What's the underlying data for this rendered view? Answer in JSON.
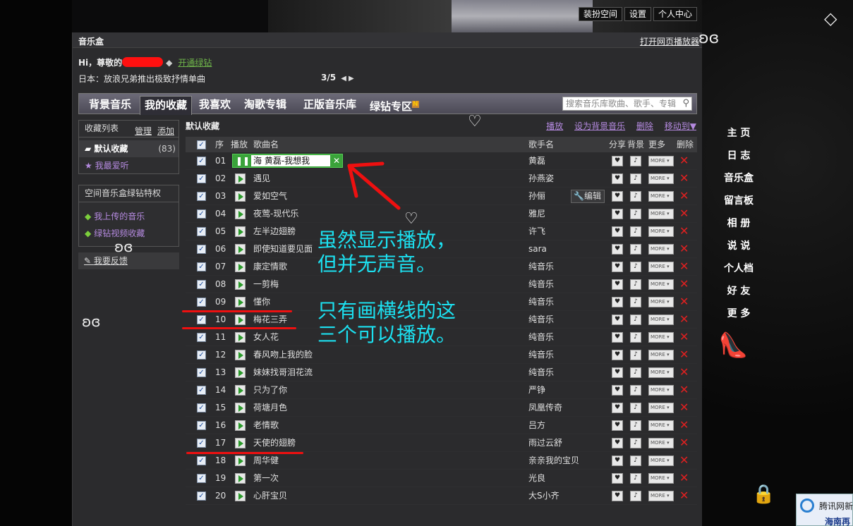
{
  "top_buttons": [
    "装扮空间",
    "设置",
    "个人中心"
  ],
  "panel": {
    "title": "音乐盒",
    "open_player": "打开网页播放器",
    "greeting_prefix": "Hi，尊敬的",
    "open_green": "开通绿钻",
    "news": "日本：放浪兄弟推出极致抒情单曲",
    "pager": "3/5"
  },
  "tabs": [
    "背景音乐",
    "我的收藏",
    "我喜欢",
    "淘歌专辑",
    "正版音乐库",
    "绿钻专区"
  ],
  "tab_badge": "N",
  "search_placeholder": "搜索音乐库歌曲、歌手、专辑",
  "sidebar": {
    "header": "收藏列表",
    "manage": "管理",
    "add": "添加",
    "items": [
      {
        "label": "默认收藏",
        "count": "(83)"
      },
      {
        "label": "我最爱听",
        "count": ""
      }
    ],
    "privilege_header": "空间音乐盒绿钻特权",
    "privilege_items": [
      "我上传的音乐",
      "绿钻视频收藏"
    ],
    "feedback": "我要反馈"
  },
  "list": {
    "title": "默认收藏",
    "actions": [
      "播放",
      "设为背景音乐",
      "删除",
      "移动到▼"
    ],
    "columns": [
      "序",
      "播放",
      "歌曲名",
      "歌手名",
      "分享",
      "背景",
      "更多",
      "删除"
    ],
    "more_label": "MORE",
    "edit_label": "编辑",
    "now_playing_text": "海 黄磊-我想我",
    "rows": [
      {
        "no": "01",
        "song": "",
        "artist": "黄磊"
      },
      {
        "no": "02",
        "song": "遇见",
        "artist": "孙燕姿"
      },
      {
        "no": "03",
        "song": "爱如空气",
        "artist": "孙俪"
      },
      {
        "no": "04",
        "song": "夜莺-现代乐",
        "artist": "雅尼"
      },
      {
        "no": "05",
        "song": "左半边翅膀",
        "artist": "许飞"
      },
      {
        "no": "06",
        "song": "即使知道要见面",
        "artist": "sara"
      },
      {
        "no": "07",
        "song": "康定情歌",
        "artist": "纯音乐"
      },
      {
        "no": "08",
        "song": "一剪梅",
        "artist": "纯音乐"
      },
      {
        "no": "09",
        "song": "懂你",
        "artist": "纯音乐"
      },
      {
        "no": "10",
        "song": "梅花三弄",
        "artist": "纯音乐"
      },
      {
        "no": "11",
        "song": "女人花",
        "artist": "纯音乐"
      },
      {
        "no": "12",
        "song": "春风吻上我的脸",
        "artist": "纯音乐"
      },
      {
        "no": "13",
        "song": "妹妹找哥泪花流",
        "artist": "纯音乐"
      },
      {
        "no": "14",
        "song": "只为了你",
        "artist": "严铮"
      },
      {
        "no": "15",
        "song": "荷塘月色",
        "artist": "凤凰传奇"
      },
      {
        "no": "16",
        "song": "老情歌",
        "artist": "吕方"
      },
      {
        "no": "17",
        "song": "天使的翅膀",
        "artist": "雨过云舒"
      },
      {
        "no": "18",
        "song": "周华健",
        "artist": "亲亲我的宝贝"
      },
      {
        "no": "19",
        "song": "第一次",
        "artist": "光良"
      },
      {
        "no": "20",
        "song": "心肝宝贝",
        "artist": "大S小齐"
      }
    ]
  },
  "right_nav": [
    "主 页",
    "日 志",
    "音乐盒",
    "留言板",
    "相 册",
    "说 说",
    "个人档",
    "好 友",
    "更 多"
  ],
  "annotation": {
    "line1": "虽然显示播放，",
    "line2": "但并无声音。",
    "line3": "只有画横线的这",
    "line4": "三个可以播放。",
    "color": "#1ce0f0"
  },
  "news_widget": {
    "line1": "腾讯网新",
    "line2": "海南再"
  },
  "colors": {
    "panel_bg": "#2b2b2d",
    "accent_green": "#3aa33a",
    "delete_red": "#e02020",
    "link_purple": "#b58ae0"
  }
}
